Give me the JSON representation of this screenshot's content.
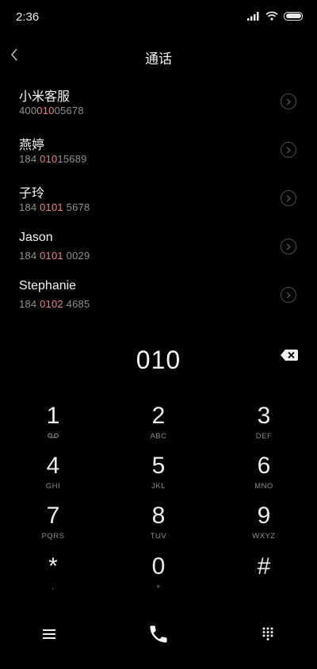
{
  "status_bar": {
    "time": "2:36",
    "icons": [
      "signal-icon",
      "wifi-icon",
      "battery-icon"
    ]
  },
  "header": {
    "title": "通话",
    "back_icon": "chevron-left-icon"
  },
  "contacts": [
    {
      "name": "小米客服",
      "number_pre": "400",
      "number_match": "010",
      "number_post": "05678"
    },
    {
      "name": "燕婷",
      "number_pre": "184 ",
      "number_match": "010",
      "number_post": "15689"
    },
    {
      "name": "子玲",
      "number_pre": "184 ",
      "number_match": "0101",
      "number_post": " 5678"
    },
    {
      "name": "Jason",
      "number_pre": "184 ",
      "number_match": "0101",
      "number_post": " 0029"
    },
    {
      "name": "Stephanie",
      "number_pre": "184 ",
      "number_match": "0102",
      "number_post": " 4685"
    }
  ],
  "dialer": {
    "input": "010",
    "backspace_icon": "backspace-icon"
  },
  "keypad": [
    {
      "digit": "1",
      "letters": "",
      "icon": "voicemail-icon"
    },
    {
      "digit": "2",
      "letters": "ABC"
    },
    {
      "digit": "3",
      "letters": "DEF"
    },
    {
      "digit": "4",
      "letters": "GHI"
    },
    {
      "digit": "5",
      "letters": "JKL"
    },
    {
      "digit": "6",
      "letters": "MNO"
    },
    {
      "digit": "7",
      "letters": "PQRS"
    },
    {
      "digit": "8",
      "letters": "TUV"
    },
    {
      "digit": "9",
      "letters": "WXYZ"
    },
    {
      "digit": "*",
      "letters": ","
    },
    {
      "digit": "0",
      "letters": "+"
    },
    {
      "digit": "#",
      "letters": ""
    }
  ],
  "bottom_bar": {
    "menu_icon": "menu-icon",
    "call_icon": "phone-icon",
    "keypad_icon": "dialpad-icon"
  },
  "colors": {
    "background": "#000000",
    "highlight": "#e8818a",
    "secondary_text": "#8e8e8e"
  }
}
